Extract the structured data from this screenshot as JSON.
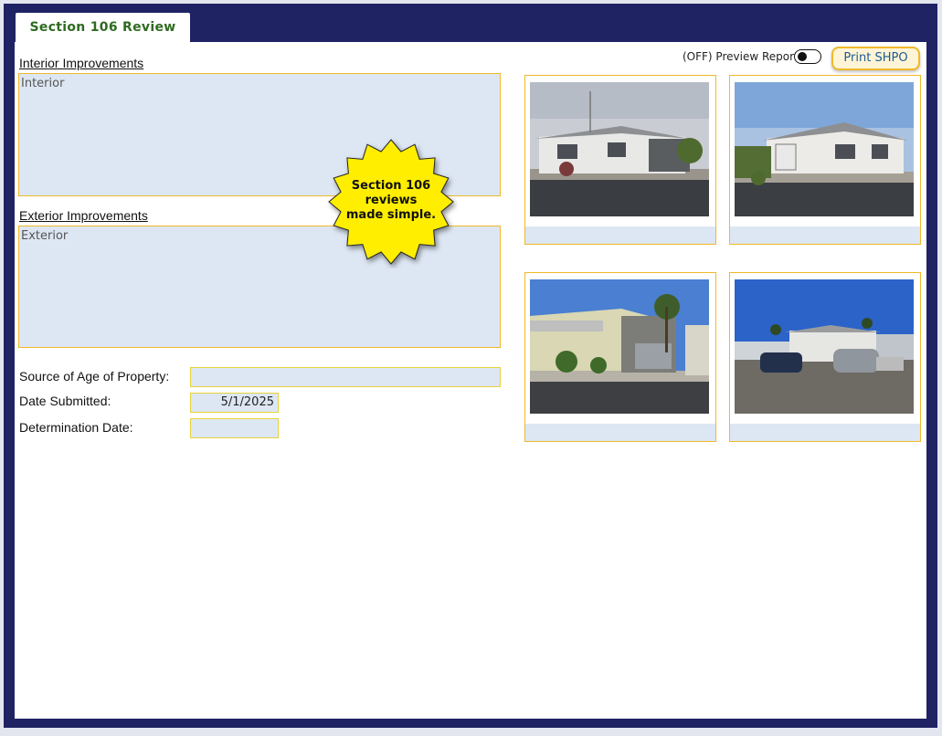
{
  "tab": {
    "label": "Section 106 Review"
  },
  "interior": {
    "label": "Interior Improvements",
    "placeholder": "Interior"
  },
  "exterior": {
    "label": "Exterior Improvements",
    "placeholder": "Exterior"
  },
  "badge": {
    "line1": "Section 106",
    "line2": "reviews",
    "line3": "made simple."
  },
  "fields": {
    "source_label": "Source of Age of Property:",
    "source_value": "",
    "date_submitted_label": "Date Submitted:",
    "date_submitted_value": "5/1/2025",
    "determination_label": "Determination Date:",
    "determination_value": ""
  },
  "preview": {
    "label": "(OFF) Preview Report:",
    "state": "off"
  },
  "print_button": {
    "label": "Print SHPO"
  },
  "colors": {
    "frame": "#1f2263",
    "field_bg": "#dde7f3",
    "field_border": "#f0b929",
    "tab_text": "#2e6b20",
    "badge": "#ffee00"
  }
}
